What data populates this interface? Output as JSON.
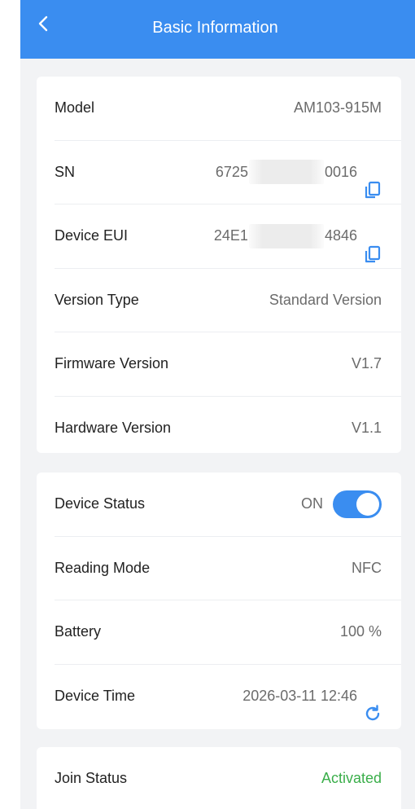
{
  "header": {
    "title": "Basic Information"
  },
  "basic_info": [
    {
      "label": "Model",
      "value": "AM103-915M"
    },
    {
      "label": "SN",
      "value_prefix": "6725",
      "value_suffix": "0016",
      "copy_icon": "copy-icon"
    },
    {
      "label": "Device EUI",
      "value_prefix": "24E1",
      "value_suffix": "4846",
      "copy_icon": "copy-icon"
    },
    {
      "label": "Version Type",
      "value": "Standard Version"
    },
    {
      "label": "Firmware Version",
      "value": "V1.7"
    },
    {
      "label": "Hardware Version",
      "value": "V1.1"
    }
  ],
  "device_status": {
    "label": "Device Status",
    "state_text": "ON",
    "enabled": true
  },
  "reading_mode": {
    "label": "Reading Mode",
    "value": "NFC"
  },
  "battery": {
    "label": "Battery",
    "value": "100 %"
  },
  "device_time": {
    "label": "Device Time",
    "value": "2026-03-11 12:46",
    "icon": "refresh-icon"
  },
  "join_status": {
    "label": "Join Status",
    "value": "Activated"
  },
  "colors": {
    "accent": "#3a8df0",
    "activated": "#3aae4a",
    "background": "#f2f3f5"
  }
}
